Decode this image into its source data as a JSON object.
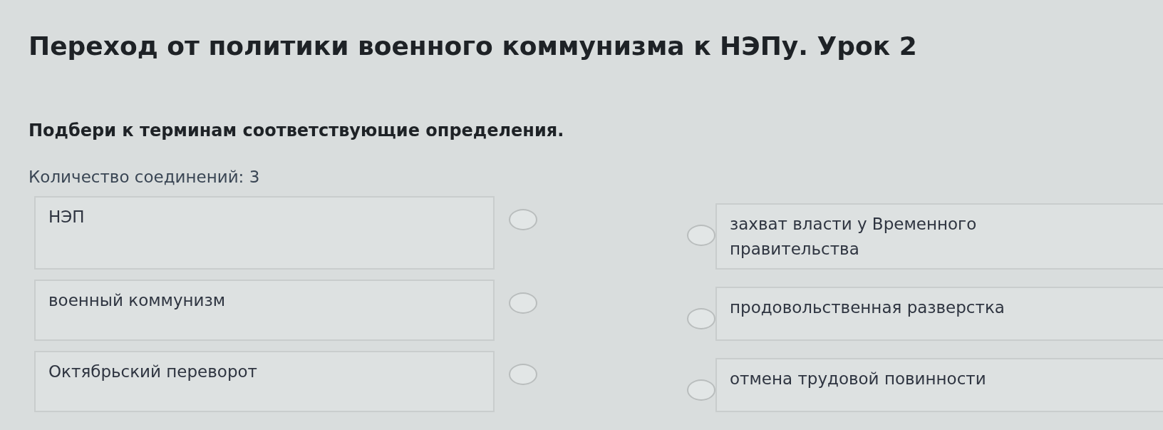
{
  "title": "Переход от политики военного коммунизма к НЭПу. Урок 2",
  "instruction": "Подбери к терминам соответствующие определения.",
  "connections": "Количество соединений: 3",
  "terms": [
    "НЭП",
    "военный коммунизм",
    "Октябрьский переворот"
  ],
  "definitions": [
    "захват власти у Временного правительства",
    "продовольственная разверстка",
    "отмена трудовой повинности"
  ]
}
